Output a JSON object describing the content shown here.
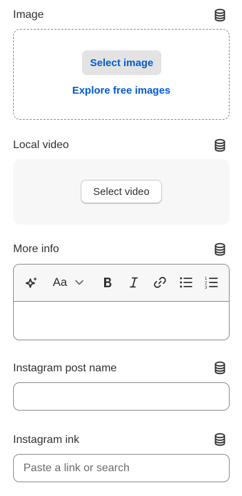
{
  "image": {
    "label": "Image",
    "select_button": "Select image",
    "explore_link": "Explore free images",
    "connect_icon": "database-icon"
  },
  "local_video": {
    "label": "Local video",
    "select_button": "Select video",
    "connect_icon": "database-icon"
  },
  "more_info": {
    "label": "More info",
    "connect_icon": "database-icon",
    "value": "",
    "toolbar": [
      "magic-sparkle-icon",
      "text-format-icon",
      "chevron-down-icon",
      "bold-icon",
      "italic-icon",
      "link-icon",
      "bulleted-list-icon",
      "numbered-list-icon"
    ],
    "text_format_label": "Aa"
  },
  "instagram_post_name": {
    "label": "Instagram post name",
    "value": "",
    "connect_icon": "database-icon"
  },
  "instagram_link": {
    "label": "Instagram ink",
    "value": "",
    "placeholder": "Paste a link or search",
    "connect_icon": "database-icon"
  },
  "colors": {
    "link_blue": "#005bd3",
    "text": "#303030",
    "border": "#8a8a8a",
    "surface": "#f7f7f7"
  }
}
